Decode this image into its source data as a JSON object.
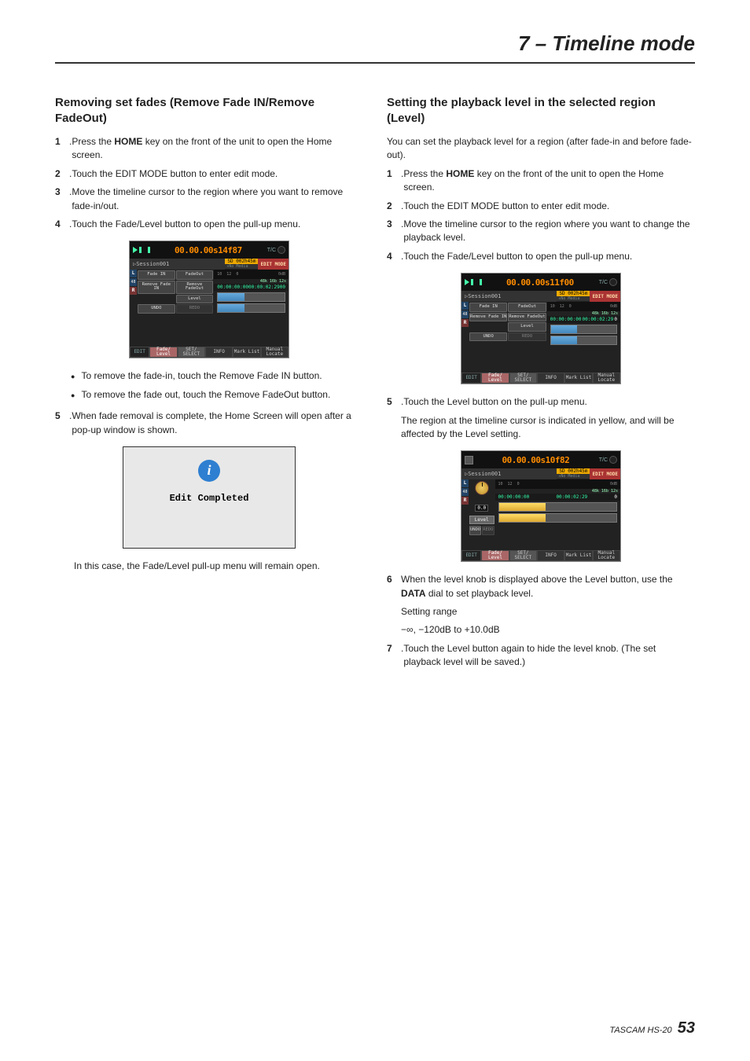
{
  "header": {
    "title": "7 – Timeline mode"
  },
  "footer": {
    "product": "TASCAM HS-20",
    "page": "53"
  },
  "left": {
    "heading": "Removing set fades (Remove Fade IN/Remove FadeOut)",
    "steps_a": [
      {
        "n": "1",
        "t_pre": "Press the ",
        "t_bold": "HOME",
        "t_post": " key on the front of the unit to open the Home screen."
      },
      {
        "n": "2",
        "t": "Touch the EDIT MODE button to enter edit mode."
      },
      {
        "n": "3",
        "t": "Move the timeline cursor to the region where you want to remove fade-in/out."
      },
      {
        "n": "4",
        "t": "Touch the Fade/Level button to open the pull-up menu."
      }
    ],
    "bullets": [
      "To remove the fade-in, touch the Remove Fade IN button.",
      "To remove the fade out, touch the Remove FadeOut button."
    ],
    "steps_b": [
      {
        "n": "5",
        "t": "When fade removal is complete, the Home Screen will open after a pop-up window is shown."
      }
    ],
    "dialog": {
      "text": "Edit Completed"
    },
    "post_dialog": "In this case, the Fade/Level pull-up menu will remain open."
  },
  "right": {
    "heading": "Setting the playback level in the selected region (Level)",
    "intro": "You can set the playback level for a region (after fade-in and before fade-out).",
    "steps_c": [
      {
        "n": "1",
        "t_pre": "Press the ",
        "t_bold": "HOME",
        "t_post": " key on the front of the unit to open the Home screen."
      },
      {
        "n": "2",
        "t": "Touch the EDIT MODE button to enter edit mode."
      },
      {
        "n": "3",
        "t": "Move the timeline cursor to the region where you want to change the playback level."
      },
      {
        "n": "4",
        "t": "Touch the Fade/Level button to open the pull-up menu."
      }
    ],
    "steps_d": [
      {
        "n": "5",
        "t": "Touch the Level button on the pull-up menu."
      }
    ],
    "step5_sub": "The region at the timeline cursor is indicated in yellow, and will be affected by the Level setting.",
    "steps_e": [
      {
        "n": "6",
        "t_pre": "When the level knob is displayed above the Level button, use the ",
        "t_bold": "DATA",
        "t_post": " dial to set playback level."
      }
    ],
    "range_label": "Setting range",
    "range_value": "−∞, −120dB to +10.0dB",
    "steps_f": [
      {
        "n": "7",
        "t": "Touch the Level button again to hide the level knob. (The set playback level will be saved.)"
      }
    ]
  },
  "device": {
    "tc1": "00.00.00s14f87",
    "tc2": "00.00.00s11f00",
    "tc3": "00.00.00s10f82",
    "tc_unit": "T/C",
    "session": "Session001",
    "sd": "SD  002h45m",
    "no_media": "No Media",
    "edit_mode": "EDIT MODE",
    "buttons": {
      "fadein": "Fade IN",
      "fadeout": "FadeOut",
      "rfadein": "Remove Fade IN",
      "rfadeout": "Remove FadeOut",
      "level": "Level",
      "undo": "UNDO",
      "redo": "REDO"
    },
    "meter_marks": {
      "a": "10",
      "b": "12",
      "c": "0",
      "d": "0dB"
    },
    "time_a": "00:00:00:00",
    "time_b": "00:00:02:29",
    "time_pad": "00",
    "bottom": {
      "edit": "EDIT",
      "fadelevel": "Fade/ Level",
      "setsel": "SET/ SELECT",
      "info": "INFO",
      "marklist": "Mark List",
      "manual": "Manual Locate"
    },
    "right_label": "48k 16b 12s",
    "level_value": "0.0"
  }
}
